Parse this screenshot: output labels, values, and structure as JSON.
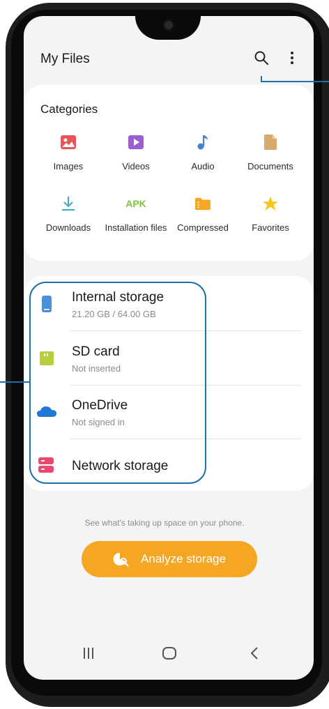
{
  "app": {
    "title": "My Files"
  },
  "header": {
    "search_icon": "search-icon",
    "more_icon": "more-vertical-icon"
  },
  "categories": {
    "title": "Categories",
    "items": [
      {
        "label": "Images",
        "icon": "images-icon",
        "color": "#e8545a"
      },
      {
        "label": "Videos",
        "icon": "videos-icon",
        "color": "#9c5fd1"
      },
      {
        "label": "Audio",
        "icon": "audio-icon",
        "color": "#4a7fd4"
      },
      {
        "label": "Documents",
        "icon": "documents-icon",
        "color": "#d9a86c"
      },
      {
        "label": "Downloads",
        "icon": "downloads-icon",
        "color": "#3fa9c9"
      },
      {
        "label": "Installation files",
        "icon": "apk-icon",
        "color": "#7cc43a",
        "badge": "APK"
      },
      {
        "label": "Compressed",
        "icon": "compressed-icon",
        "color": "#f5a623"
      },
      {
        "label": "Favorites",
        "icon": "favorites-icon",
        "color": "#f5c518"
      }
    ]
  },
  "storage": {
    "items": [
      {
        "name": "Internal storage",
        "sub": "21.20 GB / 64.00 GB",
        "icon": "phone-storage-icon",
        "color": "#4a90d9"
      },
      {
        "name": "SD card",
        "sub": "Not inserted",
        "icon": "sd-card-icon",
        "color": "#b7cf3c"
      },
      {
        "name": "OneDrive",
        "sub": "Not signed in",
        "icon": "onedrive-icon",
        "color": "#1e78d4"
      },
      {
        "name": "Network storage",
        "sub": "",
        "icon": "network-storage-icon",
        "color": "#e84a6f"
      }
    ]
  },
  "footer": {
    "hint": "See what's taking up space on your phone.",
    "analyze_label": "Analyze storage",
    "analyze_icon": "analyze-icon",
    "accent": "#f5a623"
  },
  "navbar": {
    "recent": "recent-apps-icon",
    "home": "home-icon",
    "back": "back-icon"
  }
}
